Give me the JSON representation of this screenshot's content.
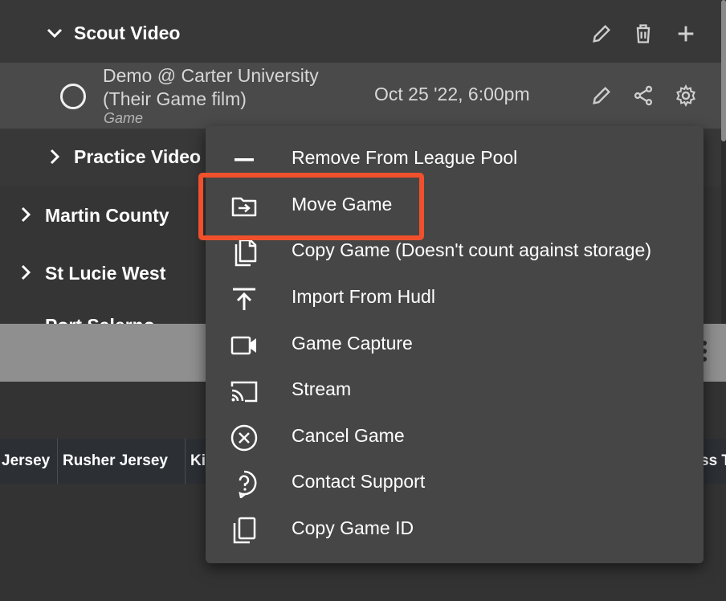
{
  "tree": {
    "scout_folder": {
      "label": "Scout Video",
      "expanded": true
    },
    "game": {
      "title": "Demo @ Carter University (Their Game film)",
      "type": "Game",
      "date": "Oct 25 '22, 6:00pm"
    },
    "practice_folder": {
      "label": "Practice Video"
    },
    "teams": [
      {
        "label": "Martin County"
      },
      {
        "label": "St Lucie West"
      },
      {
        "label": "Port Salerno"
      }
    ]
  },
  "table": {
    "columns": [
      "Jersey",
      "Rusher Jersey",
      "Ki",
      "ss T"
    ]
  },
  "context_menu": {
    "items": [
      {
        "label": "Remove From League Pool",
        "icon": "minus-icon"
      },
      {
        "label": "Move Game",
        "icon": "folder-move-icon"
      },
      {
        "label": "Copy Game (Doesn't count against storage)",
        "icon": "copy-icon"
      },
      {
        "label": "Import From Hudl",
        "icon": "upload-icon"
      },
      {
        "label": "Game Capture",
        "icon": "video-camera-icon"
      },
      {
        "label": "Stream",
        "icon": "cast-icon"
      },
      {
        "label": "Cancel Game",
        "icon": "cancel-circle-icon"
      },
      {
        "label": "Contact Support",
        "icon": "help-bubble-icon"
      },
      {
        "label": "Copy Game ID",
        "icon": "copy-id-icon"
      }
    ],
    "highlighted_item": "Move Game"
  },
  "colors": {
    "highlight": "#f0502c",
    "menu_bg": "#464646",
    "selected_row": "#4a4a4a"
  }
}
